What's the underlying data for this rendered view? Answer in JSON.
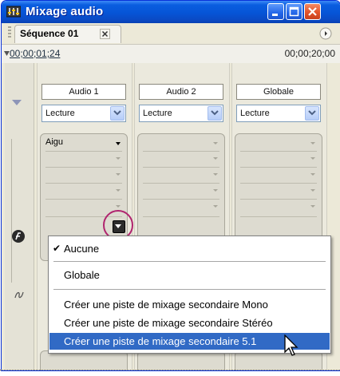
{
  "window": {
    "title": "Mixage audio",
    "icon": "audio-mixer-app-icon",
    "controls": [
      "minimize",
      "maximize",
      "close"
    ]
  },
  "panel": {
    "tab_label": "Séquence 01",
    "tab_close_icon": "close-icon",
    "menu_icon": "panel-menu-icon"
  },
  "timecode": {
    "current": "00;00;01;24",
    "duration": "00;00;20;00"
  },
  "channels": [
    {
      "name": "Audio 1",
      "mode": "Lecture",
      "effect_slot": "Aigu"
    },
    {
      "name": "Audio 2",
      "mode": "Lecture",
      "effect_slot": ""
    },
    {
      "name": "Globale",
      "mode": "Lecture",
      "effect_slot": ""
    }
  ],
  "context_menu": {
    "items": [
      {
        "label": "Aucune",
        "checked": true
      },
      {
        "label": "Globale",
        "checked": false
      },
      {
        "label": "Créer une piste de mixage secondaire Mono",
        "checked": false
      },
      {
        "label": "Créer une piste de mixage secondaire Stéréo",
        "checked": false
      },
      {
        "label": "Créer une piste de mixage secondaire 5.1",
        "checked": false,
        "highlighted": true
      }
    ]
  },
  "colors": {
    "titlebar": "#0a5ee0",
    "menu_highlight": "#316ac5",
    "callout_circle": "#b0246e"
  }
}
